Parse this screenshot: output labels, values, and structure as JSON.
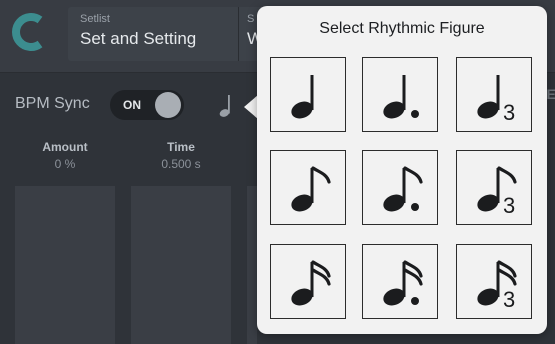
{
  "header": {
    "setlist_label": "Setlist",
    "setlist_value": "Set and Setting",
    "song_label": "S",
    "song_value": "W",
    "right_fragment": "TE"
  },
  "bpm_sync": {
    "label": "BPM Sync",
    "toggle_text": "ON",
    "state": "on"
  },
  "params": [
    {
      "name": "Amount",
      "value": "0 %"
    },
    {
      "name": "Time",
      "value": "0.500 s"
    }
  ],
  "popup": {
    "title": "Select Rhythmic Figure",
    "figures": [
      {
        "icon": "quarter-note-icon"
      },
      {
        "icon": "dotted-quarter-note-icon"
      },
      {
        "icon": "quarter-triplet-note-icon",
        "mark": "3"
      },
      {
        "icon": "eighth-note-icon"
      },
      {
        "icon": "dotted-eighth-note-icon"
      },
      {
        "icon": "eighth-triplet-note-icon",
        "mark": "3"
      },
      {
        "icon": "sixteenth-note-icon"
      },
      {
        "icon": "dotted-sixteenth-note-icon"
      },
      {
        "icon": "sixteenth-triplet-note-icon",
        "mark": "3"
      }
    ]
  },
  "colors": {
    "background": "#2f3339",
    "accent": "#3c8d8f",
    "popup": "#f2f2f2"
  }
}
